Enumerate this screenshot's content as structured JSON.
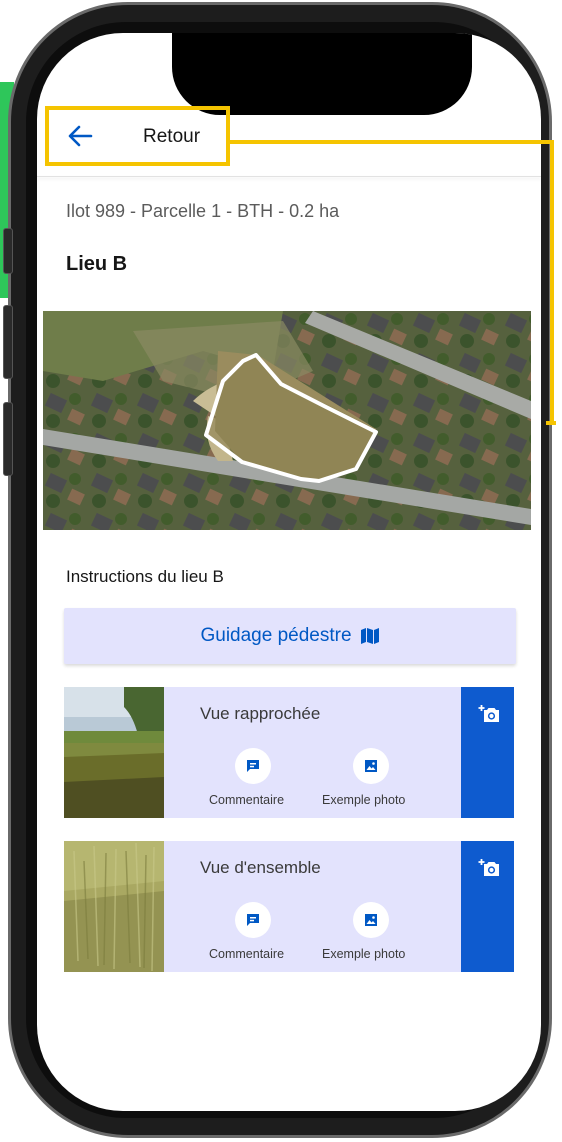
{
  "header": {
    "back_label": "Retour"
  },
  "parcel": {
    "subtitle": "Ilot 989 - Parcelle 1 - BTH - 0.2 ha",
    "title": "Lieu B"
  },
  "instructions": {
    "heading": "Instructions du lieu B"
  },
  "guidance": {
    "label": "Guidage pédestre",
    "icon": "map-icon"
  },
  "cards": [
    {
      "title": "Vue rapprochée",
      "comment_label": "Commentaire",
      "example_label": "Exemple photo",
      "photo_icon": "camera-plus-icon"
    },
    {
      "title": "Vue d'ensemble",
      "comment_label": "Commentaire",
      "example_label": "Exemple photo",
      "photo_icon": "camera-plus-icon"
    }
  ],
  "colors": {
    "accent": "#0058c4",
    "card_bg": "#e3e3fd",
    "camera_button": "#0e5bcf",
    "highlight": "#f5c400",
    "side_tab": "#2ec65a"
  }
}
